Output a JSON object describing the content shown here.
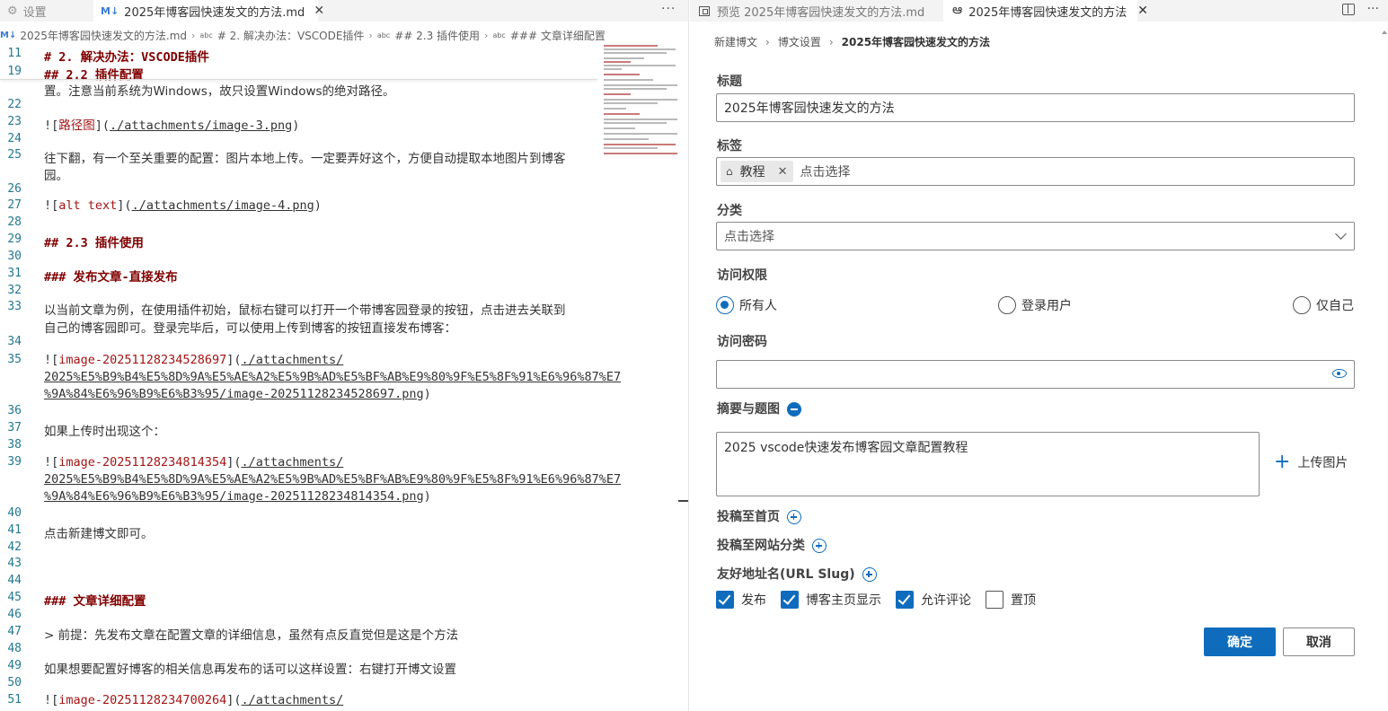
{
  "left_tabs": {
    "settings_label": "设置",
    "active_label": "2025年博客园快速发文的方法.md",
    "more": "···"
  },
  "breadcrumb": {
    "file": "2025年博客园快速发文的方法.md",
    "h1": "# 2. 解决办法：VSCODE插件",
    "h2": "## 2.3 插件使用",
    "h3": "### 文章详细配置"
  },
  "editor_lines": [
    {
      "n": "11",
      "t": "# 2. 解决办法：VSCODE插件"
    },
    {
      "n": "19",
      "t": "## 2.2 插件配置"
    },
    {
      "n": "",
      "t": "置。注意当前系统为Windows，故只设置Windows的绝对路径。"
    },
    {
      "n": "22",
      "t": ""
    },
    {
      "n": "23",
      "a": "![",
      "b": "路径图",
      "c": "](",
      "d": "./attachments/image-3.png",
      "e": ")"
    },
    {
      "n": "24",
      "t": ""
    },
    {
      "n": "25",
      "t": "往下翻，有一个至关重要的配置：图片本地上传。一定要弄好这个，方便自动提取本地图片到博客"
    },
    {
      "n": "",
      "t": "园。"
    },
    {
      "n": "26",
      "t": ""
    },
    {
      "n": "27",
      "a": "![",
      "b": "alt text",
      "c": "](",
      "d": "./attachments/image-4.png",
      "e": ")"
    },
    {
      "n": "28",
      "t": ""
    },
    {
      "n": "29",
      "t": "## 2.3 插件使用"
    },
    {
      "n": "30",
      "t": ""
    },
    {
      "n": "31",
      "t": "### 发布文章-直接发布"
    },
    {
      "n": "32",
      "t": ""
    },
    {
      "n": "33",
      "t": "以当前文章为例，在使用插件初始，鼠标右键可以打开一个带博客园登录的按钮，点击进去关联到"
    },
    {
      "n": "",
      "t": "自己的博客园即可。登录完毕后，可以使用上传到博客的按钮直接发布博客："
    },
    {
      "n": "34",
      "t": ""
    },
    {
      "n": "35",
      "a": "![",
      "b": "image-20251128234528697",
      "c": "](",
      "d": "./attachments/",
      "e": ""
    },
    {
      "n": "",
      "u": "2025%E5%B9%B4%E5%8D%9A%E5%AE%A2%E5%9B%AD%E5%BF%AB%E9%80%9F%E5%8F%91%E6%96%87%E7"
    },
    {
      "n": "",
      "u": "%9A%84%E6%96%B9%E6%B3%95/image-20251128234528697.png",
      "e": ")"
    },
    {
      "n": "36",
      "t": ""
    },
    {
      "n": "37",
      "t": "如果上传时出现这个："
    },
    {
      "n": "38",
      "t": ""
    },
    {
      "n": "39",
      "a": "![",
      "b": "image-20251128234814354",
      "c": "](",
      "d": "./attachments/",
      "e": ""
    },
    {
      "n": "",
      "u": "2025%E5%B9%B4%E5%8D%9A%E5%AE%A2%E5%9B%AD%E5%BF%AB%E9%80%9F%E5%8F%91%E6%96%87%E7"
    },
    {
      "n": "",
      "u": "%9A%84%E6%96%B9%E6%B3%95/image-20251128234814354.png",
      "e": ")"
    },
    {
      "n": "40",
      "t": ""
    },
    {
      "n": "41",
      "t": "点击新建博文即可。"
    },
    {
      "n": "42",
      "t": ""
    },
    {
      "n": "43",
      "t": ""
    },
    {
      "n": "44",
      "t": ""
    },
    {
      "n": "45",
      "t": "### 文章详细配置"
    },
    {
      "n": "46",
      "t": ""
    },
    {
      "n": "47",
      "t": "> 前提：先发布文章在配置文章的详细信息，虽然有点反直觉但是这是个方法"
    },
    {
      "n": "48",
      "t": ""
    },
    {
      "n": "49",
      "t": "如果想要配置好博客的相关信息再发布的话可以这样设置：右键打开博文设置"
    },
    {
      "n": "50",
      "t": ""
    },
    {
      "n": "51",
      "a": "![",
      "b": "image-20251128234700264",
      "c": "](",
      "d": "./attachments/",
      "e": ""
    }
  ],
  "right_tabs": {
    "preview_label": "预览 2025年博客园快速发文的方法.md",
    "blog_label": "2025年博客园快速发文的方法"
  },
  "form_breadcrumb": {
    "a": "新建博文",
    "b": "博文设置",
    "c": "2025年博客园快速发文的方法"
  },
  "form": {
    "title_label": "标题",
    "title_value": "2025年博客园快速发文的方法",
    "tags_label": "标签",
    "tag_chip": "教程",
    "tags_placeholder": "点击选择",
    "category_label": "分类",
    "category_placeholder": "点击选择",
    "access_label": "访问权限",
    "access_options": [
      "所有人",
      "登录用户",
      "仅自己"
    ],
    "password_label": "访问密码",
    "password_value": "",
    "summary_label": "摘要与题图",
    "summary_value": "2025 vscode快速发布博客园文章配置教程",
    "upload_label": "上传图片",
    "post_home_label": "投稿至首页",
    "post_site_label": "投稿至网站分类",
    "slug_label": "友好地址名(URL Slug)",
    "checkboxes": [
      "发布",
      "博客主页显示",
      "允许评论",
      "置顶"
    ],
    "checked": [
      true,
      true,
      true,
      false
    ],
    "confirm_label": "确定",
    "cancel_label": "取消"
  },
  "colors": {
    "accent": "#0f6cbd",
    "heading": "#800000",
    "link_text": "#a31515",
    "line_number": "#237893"
  }
}
